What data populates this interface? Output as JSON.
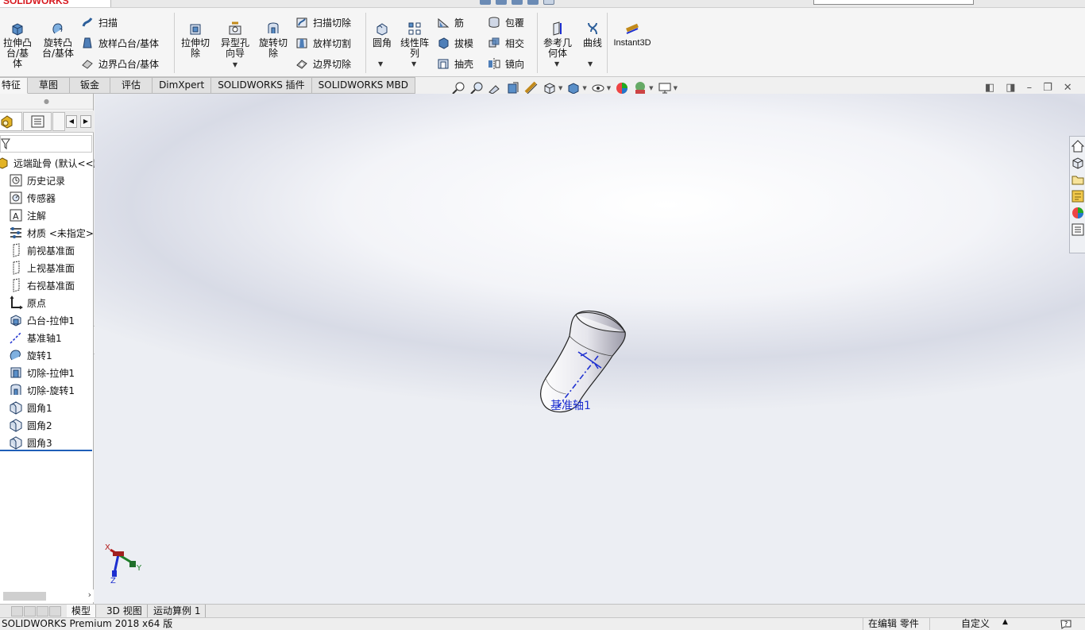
{
  "app": {
    "logo_text": "SOLIDWORKS",
    "version_status": "SOLIDWORKS Premium 2018 x64 版"
  },
  "command_manager": {
    "extrude_boss": "拉伸凸台/基体",
    "revolve_boss": "旋转凸台/基体",
    "sweep": "扫描",
    "loft_boss": "放样凸台/基体",
    "boundary_boss": "边界凸台/基体",
    "extrude_cut": "拉伸切除",
    "hole_wizard": "异型孔向导",
    "revolve_cut": "旋转切除",
    "sweep_cut": "扫描切除",
    "loft_cut": "放样切割",
    "boundary_cut": "边界切除",
    "fillet": "圆角",
    "linear_pattern": "线性阵列",
    "rib": "筋",
    "draft": "拔模",
    "shell": "抽壳",
    "wrap": "包覆",
    "intersect": "相交",
    "mirror": "镜向",
    "reference_geometry": "参考几何体",
    "curves": "曲线",
    "instant3d": "Instant3D"
  },
  "tabs": [
    "特征",
    "草图",
    "钣金",
    "评估",
    "DimXpert",
    "SOLIDWORKS 插件",
    "SOLIDWORKS MBD"
  ],
  "feature_tree": {
    "part_name": "远端趾骨 (默认<<默认>",
    "items": [
      {
        "label": "历史记录",
        "icon": "history-icon"
      },
      {
        "label": "传感器",
        "icon": "sensor-icon"
      },
      {
        "label": "注解",
        "icon": "annotation-icon"
      },
      {
        "label": "材质 <未指定>",
        "icon": "material-icon"
      },
      {
        "label": "前视基准面",
        "icon": "plane-icon"
      },
      {
        "label": "上视基准面",
        "icon": "plane-icon"
      },
      {
        "label": "右视基准面",
        "icon": "plane-icon"
      },
      {
        "label": "原点",
        "icon": "origin-icon"
      },
      {
        "label": "凸台-拉伸1",
        "icon": "extrude-icon"
      },
      {
        "label": "基准轴1",
        "icon": "axis-icon"
      },
      {
        "label": "旋转1",
        "icon": "revolve-icon"
      },
      {
        "label": "切除-拉伸1",
        "icon": "cut-extrude-icon"
      },
      {
        "label": "切除-旋转1",
        "icon": "cut-revolve-icon"
      },
      {
        "label": "圆角1",
        "icon": "fillet-icon"
      },
      {
        "label": "圆角2",
        "icon": "fillet-icon"
      },
      {
        "label": "圆角3",
        "icon": "fillet-icon"
      }
    ]
  },
  "graphics": {
    "axis_label": "基准轴1",
    "triad_x": "X",
    "triad_y": "Y",
    "triad_z": "Z"
  },
  "bottom_tabs": [
    "模型",
    "3D 视图",
    "运动算例 1"
  ],
  "status": {
    "mode": "在编辑 零件",
    "units": "自定义"
  },
  "colors": {
    "accent": "#1f5fb8",
    "brand_red": "#d7191f",
    "axis_blue": "#1d2fd0"
  }
}
